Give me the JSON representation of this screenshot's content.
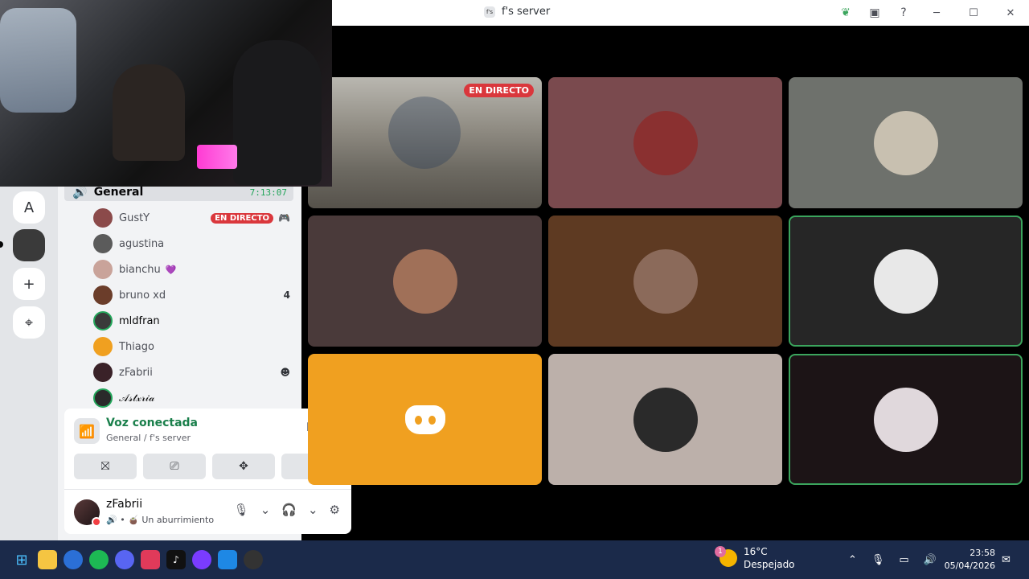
{
  "window": {
    "title": "f's server",
    "server_icon": "f's"
  },
  "rail": {
    "server_letter": "A",
    "add_label": "+",
    "explore_label": "⌖"
  },
  "channel": {
    "name": "General",
    "timer": "7:13:07",
    "members": [
      {
        "name": "GustY",
        "live": "EN DIRECTO",
        "badge": "🎮",
        "color": "#8b4a4a"
      },
      {
        "name": "agustina",
        "live": "",
        "badge": "",
        "color": "#5b5b5b"
      },
      {
        "name": "bianchu",
        "live": "",
        "badge": "",
        "color": "#c9a39a"
      },
      {
        "name": "bruno xd",
        "live": "",
        "badge": "4",
        "color": "#6b3d2a"
      },
      {
        "name": "mldfran",
        "live": "",
        "badge": "",
        "color": "#3a3a3a"
      },
      {
        "name": "Thiago",
        "live": "",
        "badge": "",
        "color": "#f0a020"
      },
      {
        "name": "zFabrii",
        "live": "",
        "badge": "☻",
        "color": "#3a2228"
      },
      {
        "name": "𝒜𝓈𝓉𝓍𝓇𝒾𝒶",
        "live": "",
        "badge": "",
        "color": "#2a2a2a"
      }
    ],
    "bianchu_emoji": "💜"
  },
  "voice": {
    "status": "Voz conectada",
    "location": "General / f's server",
    "actions": [
      "⛝",
      "⎚",
      "✥",
      "✺"
    ]
  },
  "user": {
    "name": "zFabrii",
    "status": "🔊 • 🧉 Un aburrimiento"
  },
  "grid": {
    "stream_live_label": "EN DIRECTO",
    "tiles": [
      {
        "bg": "#7a4a4e",
        "av": "#8a3030",
        "speaking": false
      },
      {
        "bg": "#6e716c",
        "av": "#c8c0b0",
        "speaking": false
      },
      {
        "bg": "#4a3a3a",
        "av": "#a07058",
        "speaking": false
      },
      {
        "bg": "#5e3a22",
        "av": "#8b6a5a",
        "speaking": false
      },
      {
        "bg": "#262626",
        "av": "#e8e8e8",
        "speaking": true
      },
      {
        "bg": "#f0a020",
        "av": "",
        "speaking": false
      },
      {
        "bg": "#bcb0aa",
        "av": "#2a2a2a",
        "speaking": false
      },
      {
        "bg": "#1c1416",
        "av": "#e0d8dc",
        "speaking": true
      }
    ]
  },
  "taskbar": {
    "weather_temp": "16°C",
    "weather_desc": "Despejado",
    "weather_badge": "1",
    "time": "23:58",
    "date": "05/04/2026"
  }
}
